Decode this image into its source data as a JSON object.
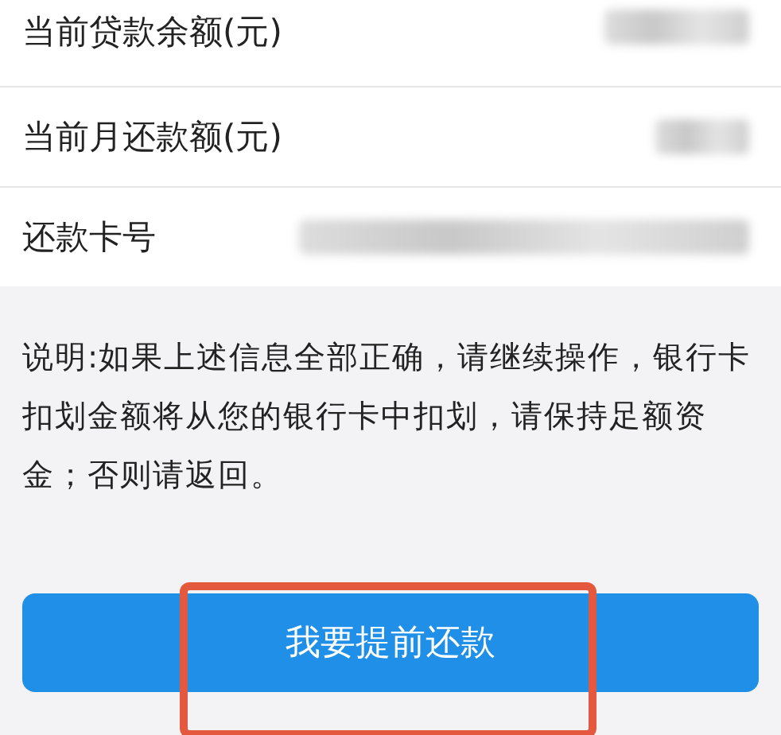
{
  "fields": [
    {
      "label": "当前贷款余额(元)"
    },
    {
      "label": "当前月还款额(元)"
    },
    {
      "label": "还款卡号"
    }
  ],
  "note": "说明:如果上述信息全部正确，请继续操作，银行卡扣划金额将从您的银行卡中扣划，请保持足额资金；否则请返回。",
  "button": {
    "label": "我要提前还款",
    "highlighted": true
  }
}
